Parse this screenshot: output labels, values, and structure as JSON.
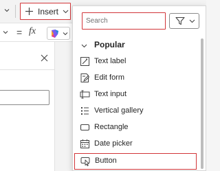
{
  "toolbar": {
    "insert_label": "Insert"
  },
  "formula_bar": {
    "equals": "=",
    "fx": "fx"
  },
  "dropdown": {
    "search": {
      "placeholder": "Search",
      "value": ""
    },
    "section_title": "Popular",
    "items": [
      {
        "label": "Text label",
        "icon": "text-label-icon"
      },
      {
        "label": "Edit form",
        "icon": "edit-form-icon"
      },
      {
        "label": "Text input",
        "icon": "text-input-icon"
      },
      {
        "label": "Vertical gallery",
        "icon": "vertical-gallery-icon"
      },
      {
        "label": "Rectangle",
        "icon": "rectangle-icon"
      },
      {
        "label": "Date picker",
        "icon": "date-picker-icon"
      },
      {
        "label": "Button",
        "icon": "button-icon"
      }
    ]
  },
  "colors": {
    "highlight": "#d13438",
    "text": "#242424",
    "border": "#8a8a8a"
  }
}
